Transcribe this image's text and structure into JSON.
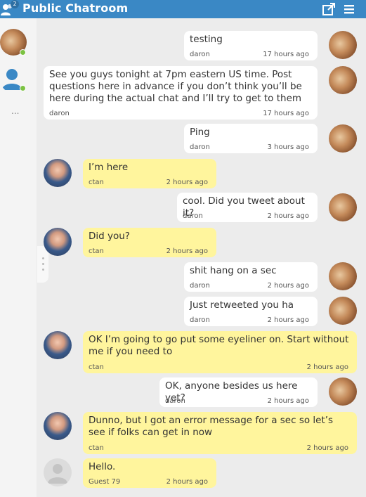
{
  "header": {
    "title": "Public Chatroom",
    "user_count": "2",
    "bg_color": "#3a88c5"
  },
  "sidebar": {
    "more_label": "..."
  },
  "messages": [
    {
      "author": "daron",
      "text": "testing",
      "time": "17 hours ago",
      "side": "right",
      "color": "white"
    },
    {
      "author": "daron",
      "text": "See you guys tonight at 7pm eastern US time. Post questions here in advance if you don’t think you’ll be here during the actual chat and I’ll try to get to them",
      "time": "17 hours ago",
      "side": "right",
      "color": "white"
    },
    {
      "author": "daron",
      "text": "Ping",
      "time": "3 hours ago",
      "side": "right",
      "color": "white"
    },
    {
      "author": "ctan",
      "text": "I’m here",
      "time": "2 hours ago",
      "side": "left",
      "color": "yellow"
    },
    {
      "author": "daron",
      "text": "cool. Did you tweet about it?",
      "time": "2 hours ago",
      "side": "right",
      "color": "white"
    },
    {
      "author": "ctan",
      "text": "Did you?",
      "time": "2 hours ago",
      "side": "left",
      "color": "yellow"
    },
    {
      "author": "daron",
      "text": "shit hang on a sec",
      "time": "2 hours ago",
      "side": "right",
      "color": "white"
    },
    {
      "author": "daron",
      "text": "Just retweeted you ha",
      "time": "2 hours ago",
      "side": "right",
      "color": "white"
    },
    {
      "author": "ctan",
      "text": "OK I’m going to go put some eyeliner on. Start without me if you need to",
      "time": "2 hours ago",
      "side": "left",
      "color": "yellow"
    },
    {
      "author": "daron",
      "text": "OK, anyone besides us here yet?",
      "time": "2 hours ago",
      "side": "right",
      "color": "white"
    },
    {
      "author": "ctan",
      "text": "Dunno, but I got an error message for a sec so let’s see if folks can get in now",
      "time": "2 hours ago",
      "side": "left",
      "color": "yellow"
    },
    {
      "author": "Guest 79",
      "text": "Hello.",
      "time": "2 hours ago",
      "side": "left",
      "color": "yellow"
    }
  ]
}
